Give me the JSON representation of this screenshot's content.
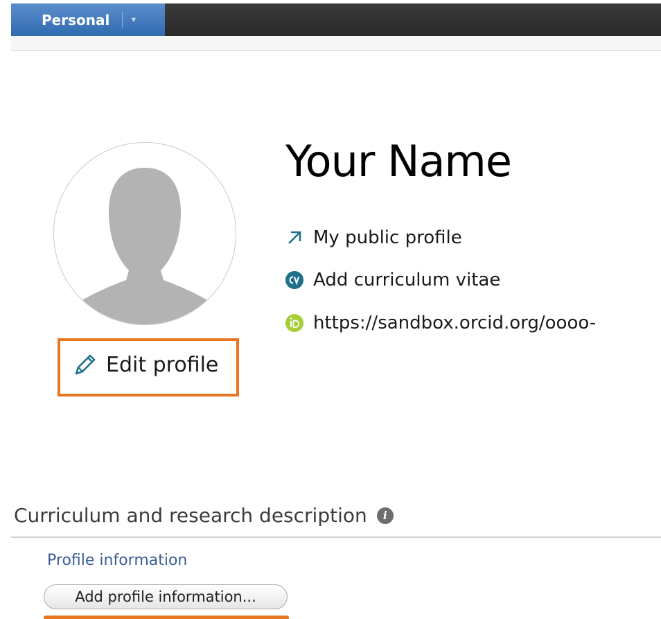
{
  "topbar": {
    "personal_tab_label": "Personal"
  },
  "profile": {
    "name": "Your Name",
    "edit_label": "Edit profile",
    "links": [
      {
        "label": "My public profile",
        "icon": "external-link-arrow-icon"
      },
      {
        "label": "Add curriculum vitae",
        "icon": "cv-icon"
      },
      {
        "label": "https://sandbox.orcid.org/oooo-",
        "icon": "orcid-id-icon"
      }
    ]
  },
  "section": {
    "title": "Curriculum and research description",
    "info_icon_glyph": "i",
    "subhead": "Profile information",
    "add_button_label": "Add profile information..."
  },
  "colors": {
    "highlight": "#e87722",
    "tab_blue": "#2f6bb0",
    "cv_teal": "#1f6f8b",
    "orcid_green": "#a6ce39",
    "link_blue": "#3a5f94"
  }
}
